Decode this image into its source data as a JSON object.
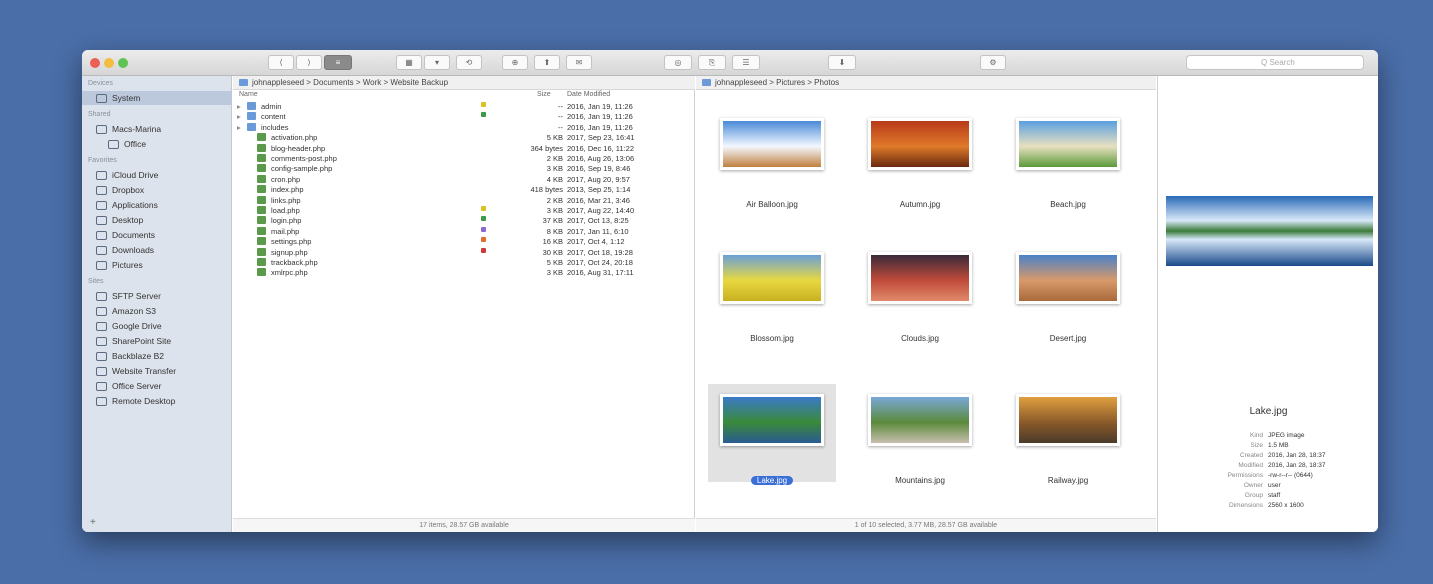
{
  "toolbar": {
    "buttons": [
      "⟨",
      "⟩",
      "≡",
      "▦",
      "▾",
      "⟲",
      "⊕",
      "⬆",
      "✉",
      "◎",
      "⎘",
      "☰",
      "⬇",
      "⚙"
    ],
    "search_placeholder": "Q Search"
  },
  "sidebar": {
    "sections": [
      {
        "title": "Devices",
        "items": [
          {
            "label": "System",
            "selected": true
          }
        ]
      },
      {
        "title": "Shared",
        "items": [
          {
            "label": "Macs-Marina",
            "selected": false
          },
          {
            "label": "Office",
            "selected": false
          }
        ]
      },
      {
        "title": "Favorites",
        "items": [
          {
            "label": "iCloud Drive",
            "selected": false
          },
          {
            "label": "Dropbox",
            "selected": false
          },
          {
            "label": "Applications",
            "selected": false
          },
          {
            "label": "Desktop",
            "selected": false
          },
          {
            "label": "Documents",
            "selected": false
          },
          {
            "label": "Downloads",
            "selected": false
          },
          {
            "label": "Pictures",
            "selected": false
          }
        ]
      },
      {
        "title": "Sites",
        "items": [
          {
            "label": "SFTP Server",
            "selected": false
          },
          {
            "label": "Amazon S3",
            "selected": false
          },
          {
            "label": "Google Drive",
            "selected": false
          },
          {
            "label": "SharePoint Site",
            "selected": false
          },
          {
            "label": "Backblaze B2",
            "selected": false
          },
          {
            "label": "Website Transfer",
            "selected": false
          },
          {
            "label": "Office Server",
            "selected": false
          },
          {
            "label": "Remote Desktop",
            "selected": false
          }
        ]
      }
    ],
    "add_label": "+"
  },
  "list_pane": {
    "path": "johnappleseed > Documents > Work > Website Backup",
    "columns": {
      "name": "Name",
      "tags": "",
      "size": "Size",
      "date": "Date Modified"
    },
    "rows": [
      {
        "name": "admin",
        "kind": "folder",
        "tag": "#e0c020",
        "size": "--",
        "date": "2016, Jan 19, 11:26"
      },
      {
        "name": "content",
        "kind": "folder",
        "tag": "#3a9a4a",
        "size": "--",
        "date": "2016, Jan 19, 11:26"
      },
      {
        "name": "includes",
        "kind": "folder",
        "tag": "",
        "size": "--",
        "date": "2016, Jan 19, 11:26"
      },
      {
        "name": "activation.php",
        "kind": "file",
        "tag": "",
        "size": "5 KB",
        "date": "2017, Sep 23, 16:41"
      },
      {
        "name": "blog-header.php",
        "kind": "file",
        "tag": "",
        "size": "364 bytes",
        "date": "2016, Dec 16, 11:22"
      },
      {
        "name": "comments-post.php",
        "kind": "file",
        "tag": "",
        "size": "2 KB",
        "date": "2016, Aug 26, 13:06"
      },
      {
        "name": "config-sample.php",
        "kind": "file",
        "tag": "",
        "size": "3 KB",
        "date": "2016, Sep 19, 8:46"
      },
      {
        "name": "cron.php",
        "kind": "file",
        "tag": "",
        "size": "4 KB",
        "date": "2017, Aug 20, 9:57"
      },
      {
        "name": "index.php",
        "kind": "file",
        "tag": "",
        "size": "418 bytes",
        "date": "2013, Sep 25, 1:14"
      },
      {
        "name": "links.php",
        "kind": "file",
        "tag": "",
        "size": "2 KB",
        "date": "2016, Mar 21, 3:46"
      },
      {
        "name": "load.php",
        "kind": "file",
        "tag": "#e0c020",
        "size": "3 KB",
        "date": "2017, Aug 22, 14:40"
      },
      {
        "name": "login.php",
        "kind": "file",
        "tag": "#3a9a4a",
        "size": "37 KB",
        "date": "2017, Oct 13, 8:25"
      },
      {
        "name": "mail.php",
        "kind": "file",
        "tag": "#8a6ad0",
        "size": "8 KB",
        "date": "2017, Jan 11, 6:10"
      },
      {
        "name": "settings.php",
        "kind": "file",
        "tag": "#e07030",
        "size": "16 KB",
        "date": "2017, Oct 4, 1:12"
      },
      {
        "name": "signup.php",
        "kind": "file",
        "tag": "#d03a3a",
        "size": "30 KB",
        "date": "2017, Oct 18, 19:28"
      },
      {
        "name": "trackback.php",
        "kind": "file",
        "tag": "",
        "size": "5 KB",
        "date": "2017, Oct 24, 20:18"
      },
      {
        "name": "xmlrpc.php",
        "kind": "file",
        "tag": "",
        "size": "3 KB",
        "date": "2016, Aug 31, 17:11"
      }
    ],
    "status": "17 items, 28.57 GB available"
  },
  "grid_pane": {
    "path": "johnappleseed > Pictures > Photos",
    "items": [
      {
        "name": "Air Balloon.jpg",
        "selected": false,
        "colors": [
          "#4a8ad8",
          "#f4f8ff",
          "#c08040"
        ]
      },
      {
        "name": "Autumn.jpg",
        "selected": false,
        "colors": [
          "#b83a1a",
          "#e07a2a",
          "#6a2a10"
        ]
      },
      {
        "name": "Beach.jpg",
        "selected": false,
        "colors": [
          "#5aa0e0",
          "#e8e0c0",
          "#5a9a3a"
        ]
      },
      {
        "name": "Blossom.jpg",
        "selected": false,
        "colors": [
          "#6aa0d8",
          "#e8d840",
          "#c8b020"
        ]
      },
      {
        "name": "Clouds.jpg",
        "selected": false,
        "colors": [
          "#3a2a3a",
          "#c04a3a",
          "#e08a6a"
        ]
      },
      {
        "name": "Desert.jpg",
        "selected": false,
        "colors": [
          "#4a80c8",
          "#d89a6a",
          "#a86a3a"
        ]
      },
      {
        "name": "Lake.jpg",
        "selected": true,
        "colors": [
          "#3a7ac8",
          "#3a8a3a",
          "#2a5a90"
        ]
      },
      {
        "name": "Mountains.jpg",
        "selected": false,
        "colors": [
          "#7aa8d8",
          "#5a8a3a",
          "#c8c0b0"
        ]
      },
      {
        "name": "Railway.jpg",
        "selected": false,
        "colors": [
          "#e0a040",
          "#8a5a2a",
          "#4a3a2a"
        ]
      }
    ],
    "status": "1 of 10 selected, 3.77 MB, 28.57 GB available"
  },
  "preview": {
    "name": "Lake.jpg",
    "colors": [
      "#2a6ab8",
      "#d8e8f8",
      "#3a7a3a",
      "#1a4a8a"
    ],
    "meta": [
      {
        "k": "Kind",
        "v": "JPEG image"
      },
      {
        "k": "Size",
        "v": "1.5 MB"
      },
      {
        "k": "Created",
        "v": "2016, Jan 28, 18:37"
      },
      {
        "k": "Modified",
        "v": "2016, Jan 28, 18:37"
      },
      {
        "k": "Permissions",
        "v": "-rw-r--r-- (0644)"
      },
      {
        "k": "Owner",
        "v": "user"
      },
      {
        "k": "Group",
        "v": "staff"
      },
      {
        "k": "Dimensions",
        "v": "2560 x 1600"
      }
    ]
  }
}
